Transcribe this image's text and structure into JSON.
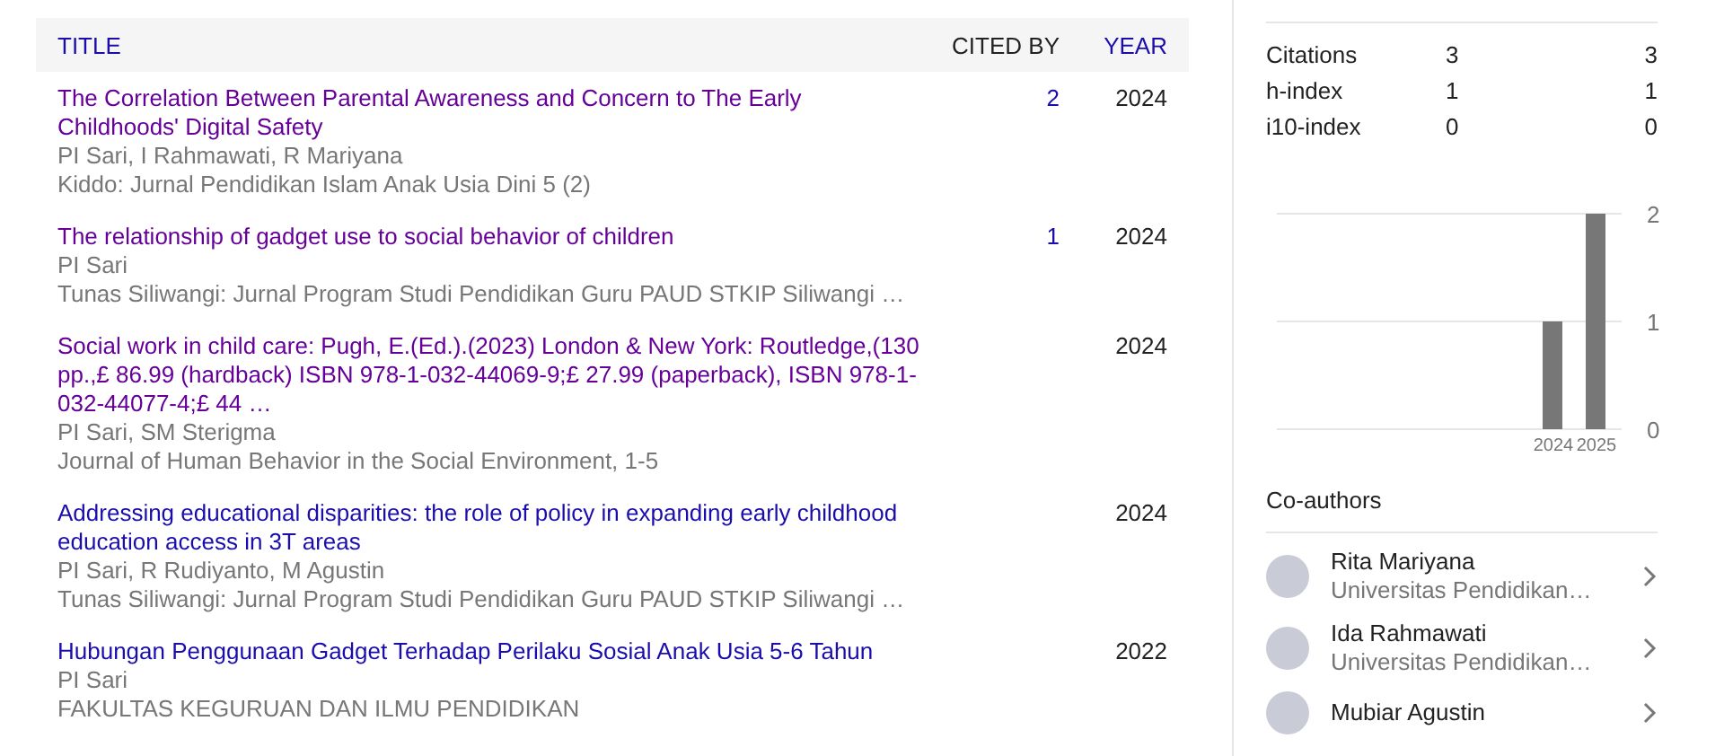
{
  "table": {
    "columns": [
      {
        "label": "TITLE",
        "sortable": true
      },
      {
        "label": "CITED BY",
        "sortable": false
      },
      {
        "label": "YEAR",
        "sortable": true
      }
    ],
    "rows": [
      {
        "title": "The Correlation Between Parental Awareness and Concern to The Early Childhoods' Digital Safety",
        "visited": true,
        "authors": "PI Sari, I Rahmawati, R Mariyana",
        "venue": "Kiddo: Jurnal Pendidikan Islam Anak Usia Dini 5 (2)",
        "cited_by": "2",
        "year": "2024"
      },
      {
        "title": "The relationship of gadget use to social behavior of children",
        "visited": true,
        "authors": "PI Sari",
        "venue": "Tunas Siliwangi: Jurnal Program Studi Pendidikan Guru PAUD STKIP Siliwangi …",
        "cited_by": "1",
        "year": "2024"
      },
      {
        "title": "Social work in child care: Pugh, E.(Ed.).(2023) London & New York: Routledge,(130 pp.,£ 86.99 (hardback) ISBN 978-1-032-44069-9;£ 27.99 (paperback), ISBN 978-1-032-44077-4;£ 44 …",
        "visited": true,
        "authors": "PI Sari, SM Sterigma",
        "venue": "Journal of Human Behavior in the Social Environment, 1-5",
        "year": "2024"
      },
      {
        "title": "Addressing educational disparities: the role of policy in expanding early childhood education access in 3T areas",
        "visited": false,
        "authors": "PI Sari, R Rudiyanto, M Agustin",
        "venue": "Tunas Siliwangi: Jurnal Program Studi Pendidikan Guru PAUD STKIP Siliwangi …",
        "year": "2024"
      },
      {
        "title": "Hubungan Penggunaan Gadget Terhadap Perilaku Sosial Anak Usia 5-6 Tahun",
        "visited": false,
        "authors": "PI Sari",
        "venue": "FAKULTAS KEGURUAN DAN ILMU PENDIDIKAN",
        "year": "2022"
      }
    ]
  },
  "stats": [
    {
      "label": "Citations",
      "all": "3",
      "since": "3"
    },
    {
      "label": "h-index",
      "all": "1",
      "since": "1"
    },
    {
      "label": "i10-index",
      "all": "0",
      "since": "0"
    }
  ],
  "citations_chart": {
    "chart_data": {
      "type": "bar",
      "categories": [
        "2024",
        "2025"
      ],
      "values": [
        1,
        2
      ],
      "ylim": [
        0,
        2
      ],
      "yticks": [
        0,
        1,
        2
      ]
    }
  },
  "coauthors": {
    "title": "Co-authors",
    "items": [
      {
        "name": "Rita Mariyana",
        "affiliation": "Universitas Pendidikan…"
      },
      {
        "name": "Ida Rahmawati",
        "affiliation": "Universitas Pendidikan…"
      },
      {
        "name": "Mubiar Agustin"
      }
    ]
  }
}
